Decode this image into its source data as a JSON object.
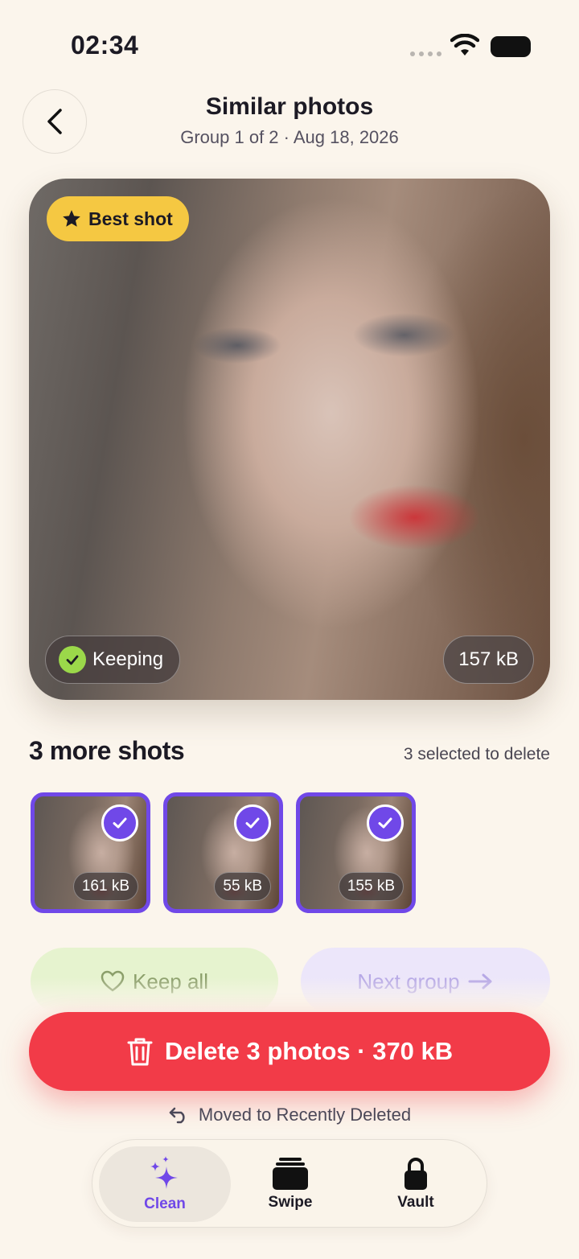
{
  "status_bar": {
    "time": "02:34"
  },
  "header": {
    "title": "Similar photos",
    "subtitle": "Group 1 of 2 · Aug 18, 2026"
  },
  "hero": {
    "best_shot_label": "Best shot",
    "keeping_label": "Keeping",
    "size": "157 kB"
  },
  "more_shots": {
    "title": "3 more shots",
    "selected_note": "3 selected to delete",
    "thumbs": [
      {
        "size": "161 kB",
        "selected": true
      },
      {
        "size": "55 kB",
        "selected": true
      },
      {
        "size": "155 kB",
        "selected": true
      }
    ]
  },
  "actions": {
    "keep_all": "Keep all",
    "next_group": "Next group",
    "delete": "Delete 3 photos · 370 kB",
    "recently_deleted_note": "Moved to Recently Deleted"
  },
  "tabs": [
    {
      "label": "Clean",
      "icon": "sparkles-icon",
      "active": true
    },
    {
      "label": "Swipe",
      "icon": "cards-stack-icon",
      "active": false
    },
    {
      "label": "Vault",
      "icon": "lock-icon",
      "active": false
    }
  ],
  "colors": {
    "background": "#fbf5ec",
    "accent_purple": "#7048e8",
    "delete_red": "#f23b48",
    "best_shot_yellow": "#f5c842",
    "keeping_green": "#9bd84a"
  }
}
